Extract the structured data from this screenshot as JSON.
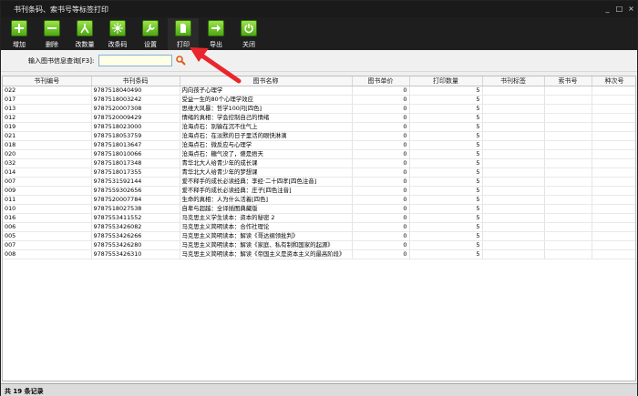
{
  "window": {
    "title": "书刊条码、索书号等标签打印"
  },
  "toolbar": {
    "buttons": [
      {
        "label": "增加",
        "icon": "plus-icon"
      },
      {
        "label": "删除",
        "icon": "minus-icon"
      },
      {
        "label": "改数量",
        "icon": "edit-quantity-icon"
      },
      {
        "label": "改条码",
        "icon": "edit-barcode-icon"
      },
      {
        "label": "设置",
        "icon": "wrench-icon"
      },
      {
        "label": "打印",
        "icon": "print-icon"
      },
      {
        "label": "导出",
        "icon": "export-arrow-icon"
      },
      {
        "label": "关闭",
        "icon": "power-icon"
      }
    ]
  },
  "search": {
    "label": "输入图书信息查询[F3]:",
    "value": ""
  },
  "table": {
    "headers": [
      "书刊编号",
      "书刊条码",
      "图书名称",
      "图书单价",
      "打印数量",
      "书刊标签",
      "索书号",
      "种次号"
    ],
    "rows": [
      [
        "022",
        "9787518040490",
        "内向孩子心理学",
        "0",
        "5",
        "",
        "",
        ""
      ],
      [
        "017",
        "9787518003242",
        "受益一生的80个心理学效应",
        "0",
        "5",
        "",
        "",
        ""
      ],
      [
        "013",
        "9787520007308",
        "思维大风暴：哲学100问[四色]",
        "0",
        "5",
        "",
        "",
        ""
      ],
      [
        "012",
        "9787520009429",
        "情绪的真相：学会控制自己的情绪",
        "0",
        "5",
        "",
        "",
        ""
      ],
      [
        "019",
        "9787518023000",
        "沧海点石：别输在沉不住气上",
        "0",
        "5",
        "",
        "",
        ""
      ],
      [
        "021",
        "9787518053759",
        "沧海点石：在淡默的日子里活的眼快淋漓",
        "0",
        "5",
        "",
        "",
        ""
      ],
      [
        "018",
        "9787518013647",
        "沧海点石：微反应与心理学",
        "0",
        "5",
        "",
        "",
        ""
      ],
      [
        "020",
        "9787518010066",
        "沧海点石：糖气没了，傻是捂天",
        "0",
        "5",
        "",
        "",
        ""
      ],
      [
        "032",
        "9787518017348",
        "青华北大人给青少年的成长课",
        "0",
        "5",
        "",
        "",
        ""
      ],
      [
        "014",
        "9787518017355",
        "青华北大人给青少年的梦想课",
        "0",
        "5",
        "",
        "",
        ""
      ],
      [
        "007",
        "9787531592144",
        "爱不释手的成长必读经典：李经·二十四孝[四色注音]",
        "0",
        "5",
        "",
        "",
        ""
      ],
      [
        "009",
        "9787559302656",
        "爱不释手的成长必读经典：庄子[四色注音]",
        "0",
        "5",
        "",
        "",
        ""
      ],
      [
        "011",
        "9787520007784",
        "生命的真相：人为什么活着[四色]",
        "0",
        "5",
        "",
        "",
        ""
      ],
      [
        "010",
        "9787518027538",
        "自卑与超越：全译插图典藏版",
        "0",
        "5",
        "",
        "",
        ""
      ],
      [
        "016",
        "9787553411552",
        "马克思主义学生读本：资本的秘密 2",
        "0",
        "5",
        "",
        "",
        ""
      ],
      [
        "006",
        "9787553426082",
        "马克思主义简明读本：合作社理论",
        "0",
        "5",
        "",
        "",
        ""
      ],
      [
        "005",
        "9787553426266",
        "马克思主义简明读本：解读《哥达纲领批判》",
        "0",
        "5",
        "",
        "",
        ""
      ],
      [
        "007",
        "9787553426280",
        "马克思主义简明读本：解读《家庭、私有制和国家的起源》",
        "0",
        "5",
        "",
        "",
        ""
      ],
      [
        "008",
        "9787553426310",
        "马克思主义简明读本：解读《帝国主义是资本主义的最高阶段》",
        "0",
        "5",
        "",
        "",
        ""
      ]
    ]
  },
  "status": {
    "text": "共 19 条记录"
  },
  "colors": {
    "accent_arrow": "#e8262b",
    "toolbar_bg": "#1e1e1e",
    "icon_green": "#6cc52c"
  }
}
